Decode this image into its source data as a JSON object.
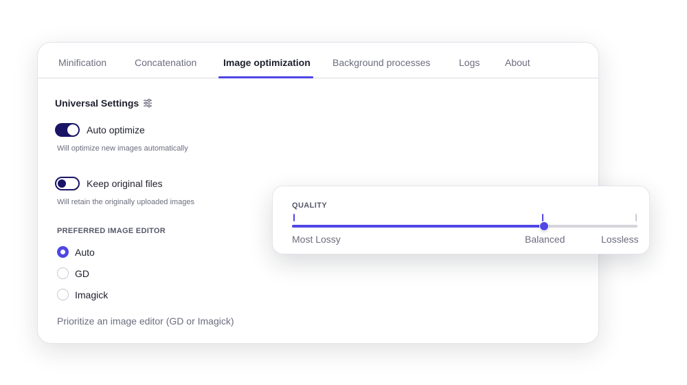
{
  "tabs": [
    {
      "label": "Minification",
      "active": false
    },
    {
      "label": "Concatenation",
      "active": false
    },
    {
      "label": "Image optimization",
      "active": true
    },
    {
      "label": "Background processes",
      "active": false
    },
    {
      "label": "Logs",
      "active": false
    },
    {
      "label": "About",
      "active": false
    }
  ],
  "universal": {
    "title": "Universal Settings",
    "title_icon": "sliders-icon"
  },
  "toggles": [
    {
      "label": "Auto optimize",
      "hint": "Will optimize new images automatically",
      "on": true
    },
    {
      "label": "Keep original files",
      "hint": "Will retain the originally uploaded images",
      "on": false
    }
  ],
  "editor": {
    "label": "PREFERRED IMAGE EDITOR",
    "options": [
      {
        "label": "Auto",
        "selected": true
      },
      {
        "label": "GD",
        "selected": false
      },
      {
        "label": "Imagick",
        "selected": false
      }
    ],
    "footnote": "Prioritize an image editor (GD or Imagick)"
  },
  "quality": {
    "title": "QUALITY",
    "value": 0.73,
    "labels": [
      "Most Lossy",
      "Balanced",
      "Lossless"
    ]
  },
  "colors": {
    "accent": "#4f46e5",
    "toggle_dark": "#1a1466",
    "tick_inactive": "#c9c9d2"
  }
}
